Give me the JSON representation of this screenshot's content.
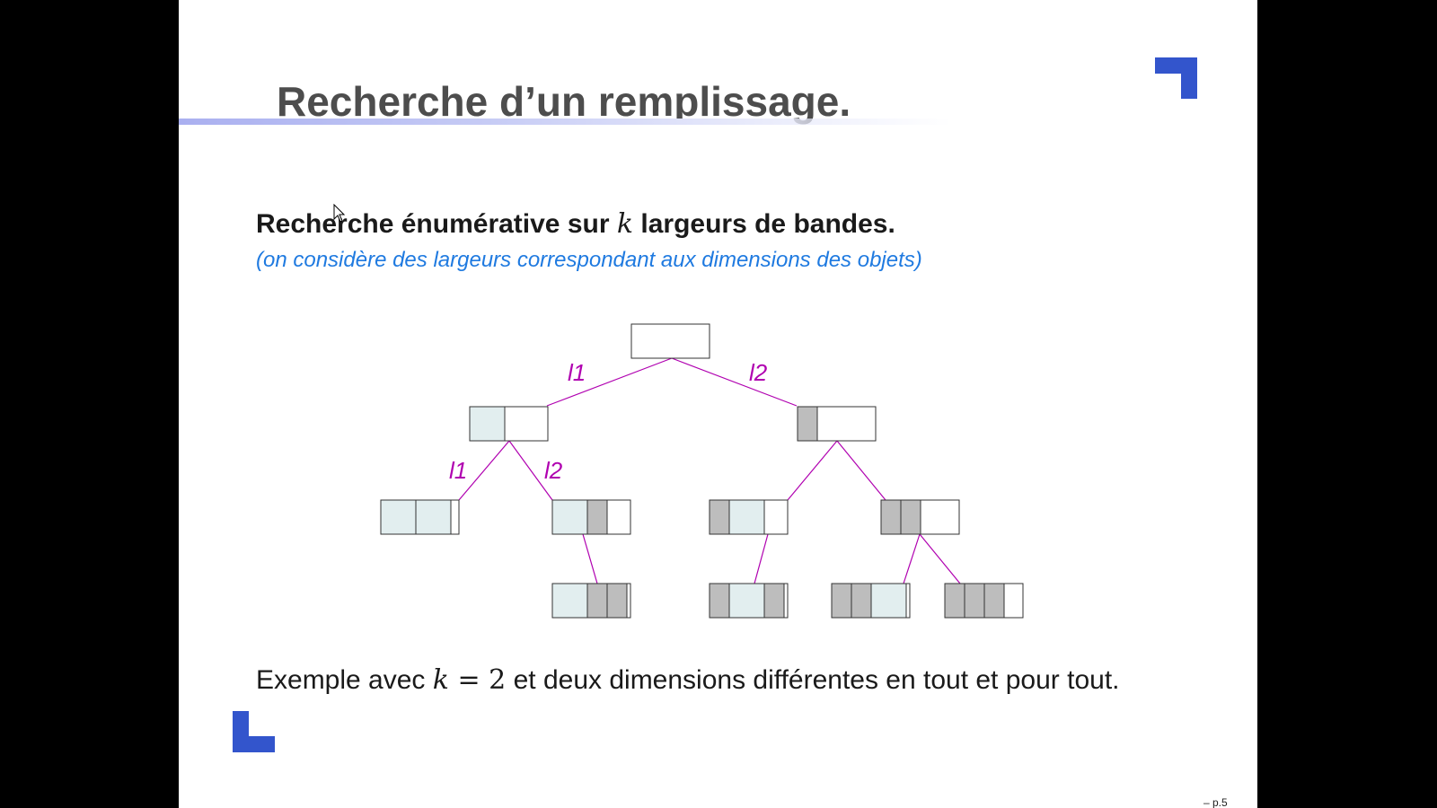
{
  "slide": {
    "title": "Recherche d’un remplissage.",
    "subtitle": {
      "before": "Recherche énumérative sur ",
      "var": "k",
      "after": " largeurs de bandes."
    },
    "note": "(on considère des largeurs correspondant aux dimensions des objets)",
    "example": {
      "before": "Exemple avec ",
      "var": "k",
      "eq": " = ",
      "value": "2",
      "after": " et deux dimensions différentes en tout et pour tout."
    },
    "page_number": "– p.5"
  },
  "tree": {
    "edge_labels": [
      "l1",
      "l2",
      "l1",
      "l2"
    ]
  },
  "colors": {
    "accent_blue": "#3355cc",
    "edge_magenta": "#b000b0",
    "light_strip": "#e2eeef",
    "gray_strip": "#bdbdbd",
    "note_blue": "#1f7ae0",
    "title_gray": "#4d4d4d"
  }
}
